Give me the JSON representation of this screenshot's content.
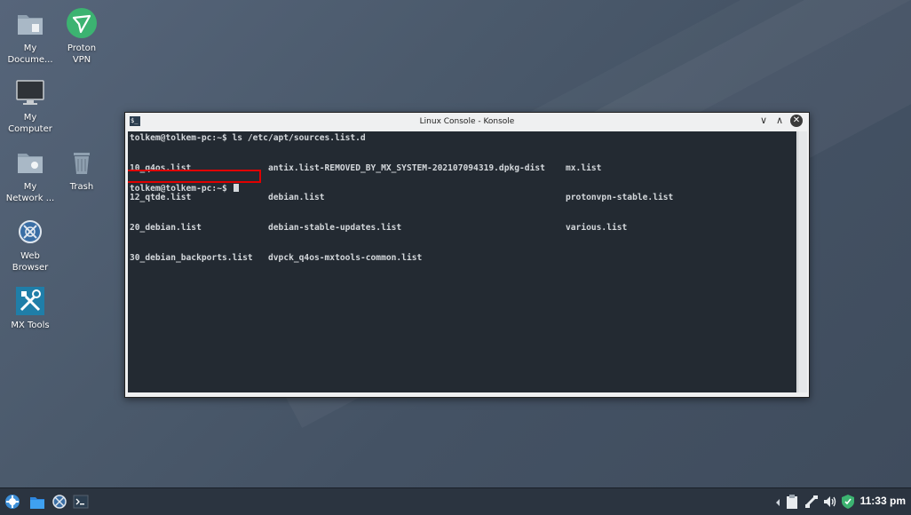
{
  "desktop": {
    "icons": [
      {
        "label": "My\nDocume..."
      },
      {
        "label": "Proton\nVPN"
      },
      {
        "label": "My\nComputer"
      },
      {
        "label": "My\nNetwork ..."
      },
      {
        "label": "Trash"
      },
      {
        "label": "Web\nBrowser"
      },
      {
        "label": "MX Tools"
      }
    ]
  },
  "window": {
    "title": "Linux Console - Konsole",
    "icon_glyph": "$_",
    "buttons": {
      "minimize": "∨",
      "maximize": "∧",
      "close": "✕"
    }
  },
  "terminal": {
    "prompt_line": "tolkem@tolkem-pc:~$ ls /etc/apt/sources.list.d",
    "columns": [
      [
        "10_q4os.list",
        "12_qtde.list",
        "20_debian.list",
        "30_debian_backports.list"
      ],
      [
        "antix.list-REMOVED_BY_MX_SYSTEM-202107094319.dpkg-dist",
        "debian.list",
        "debian-stable-updates.list",
        "dvpck_q4os-mxtools-common.list"
      ],
      [
        "mx.list",
        "protonvpn-stable.list",
        "various.list"
      ]
    ],
    "last_prompt": "tolkem@tolkem-pc:~$ "
  },
  "taskbar": {
    "clock": "11:33 pm",
    "left_icons": [
      "start-menu-icon",
      "file-manager-icon",
      "web-browser-icon",
      "konsole-icon"
    ],
    "tray_icons": [
      "tray-arrow-icon",
      "clipboard-icon",
      "network-icon",
      "volume-icon",
      "vpn-shield-icon"
    ]
  },
  "colors": {
    "terminal_bg": "#232a32",
    "terminal_fg": "#d4d8dc",
    "highlight": "#e00000",
    "taskbar": "#2b3440"
  }
}
